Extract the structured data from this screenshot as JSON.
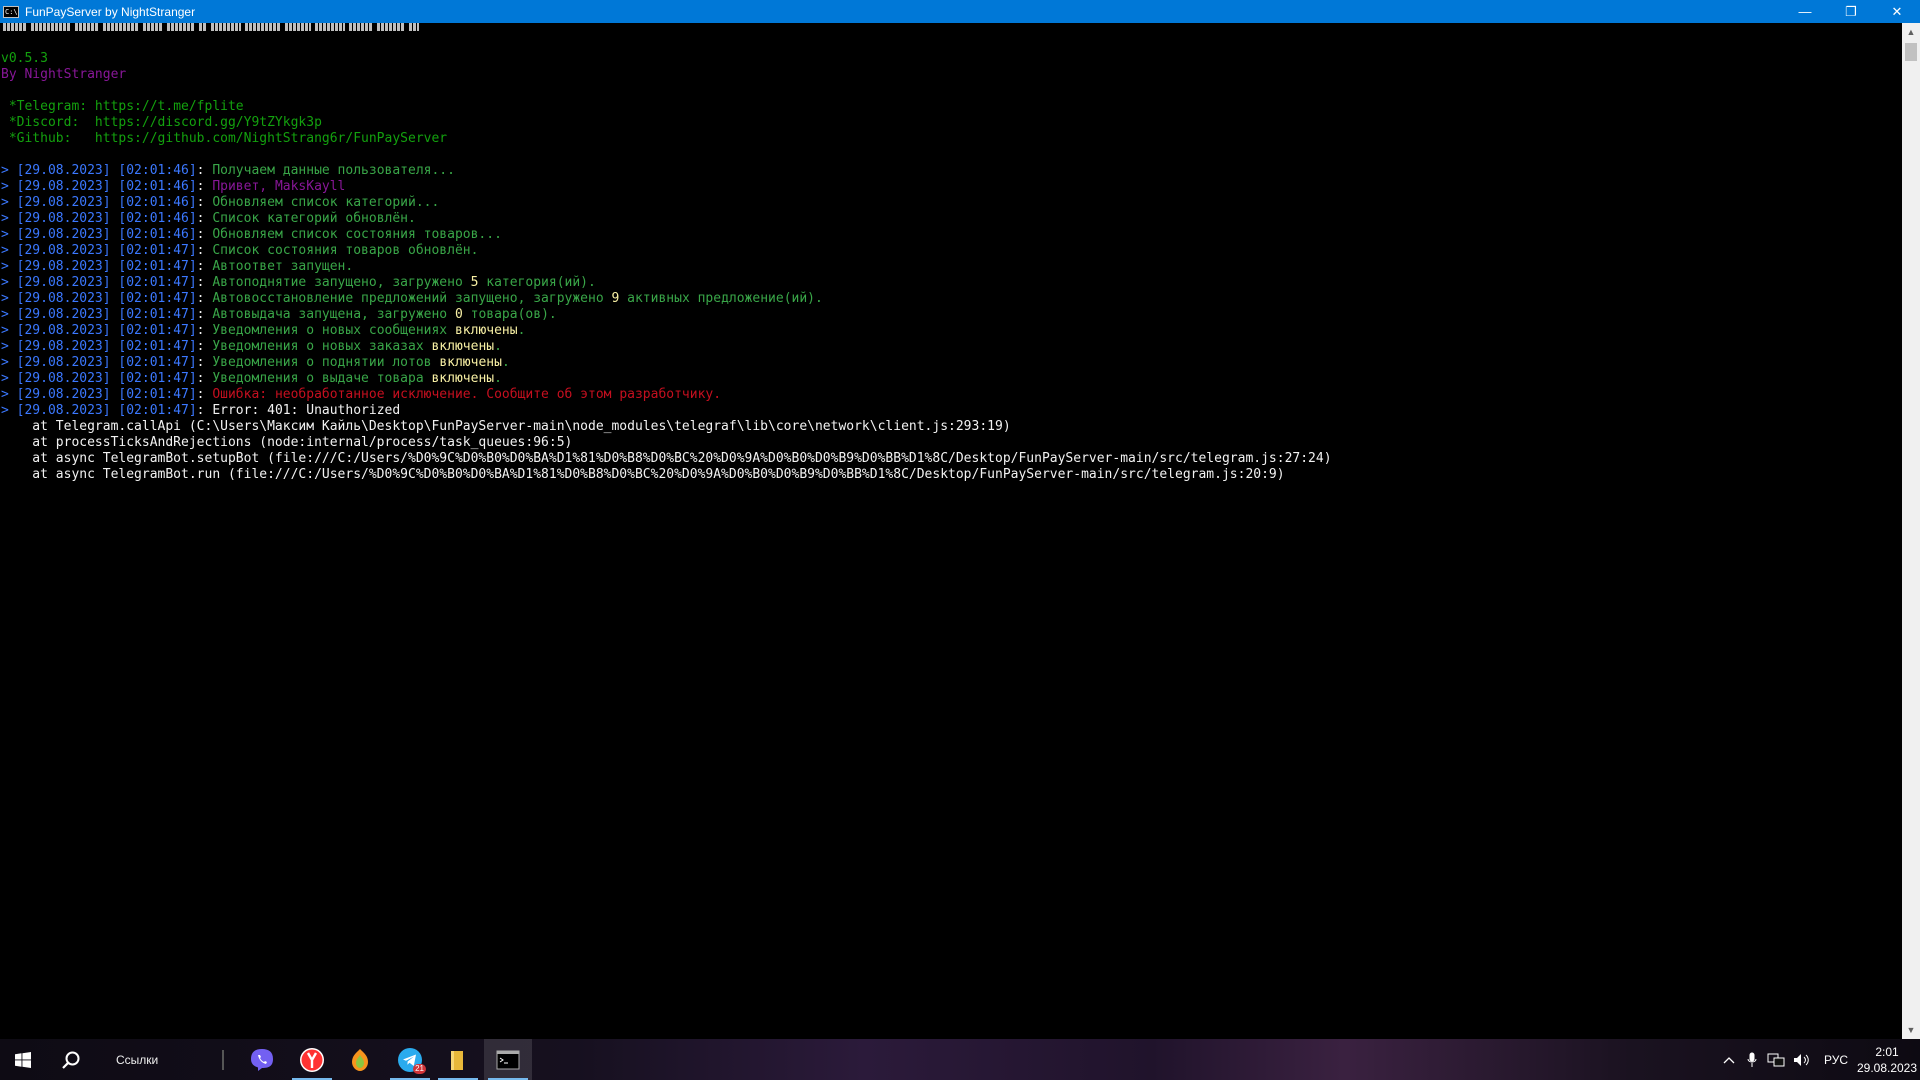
{
  "window": {
    "title": "FunPayServer by NightStranger",
    "app_icon_glyph": "C:\\",
    "minimize_glyph": "—",
    "restore_glyph": "❐",
    "close_glyph": "✕"
  },
  "colors": {
    "gray": "#cccccc",
    "green": "#13a10e",
    "dim_green": "#39a648",
    "magenta": "#881798",
    "yellow": "#f9f1a5",
    "white": "#f2f2f2",
    "red": "#c50f1f",
    "prompt": "#3b78ff"
  },
  "console": {
    "version": "v0.5.3",
    "author": "By NightStranger",
    "links": [
      {
        "label": " *Telegram: ",
        "value": "https://t.me/fplite"
      },
      {
        "label": " *Discord:  ",
        "value": "https://discord.gg/Y9tZYkgk3p"
      },
      {
        "label": " *Github:   ",
        "value": "https://github.com/NightStrang6r/FunPayServer"
      }
    ],
    "log": [
      {
        "ts": "[29.08.2023] [02:01:46]",
        "parts": [
          {
            "t": "Получаем данные пользователя...",
            "c": "dim_green"
          }
        ]
      },
      {
        "ts": "[29.08.2023] [02:01:46]",
        "parts": [
          {
            "t": "Привет, MaksKayll",
            "c": "magenta"
          }
        ]
      },
      {
        "ts": "[29.08.2023] [02:01:46]",
        "parts": [
          {
            "t": "Обновляем список категорий...",
            "c": "dim_green"
          }
        ]
      },
      {
        "ts": "[29.08.2023] [02:01:46]",
        "parts": [
          {
            "t": "Список категорий обновлён.",
            "c": "dim_green"
          }
        ]
      },
      {
        "ts": "[29.08.2023] [02:01:46]",
        "parts": [
          {
            "t": "Обновляем список состояния товаров...",
            "c": "dim_green"
          }
        ]
      },
      {
        "ts": "[29.08.2023] [02:01:47]",
        "parts": [
          {
            "t": "Список состояния товаров обновлён.",
            "c": "dim_green"
          }
        ]
      },
      {
        "ts": "[29.08.2023] [02:01:47]",
        "parts": [
          {
            "t": "Автоответ запущен.",
            "c": "dim_green"
          }
        ]
      },
      {
        "ts": "[29.08.2023] [02:01:47]",
        "parts": [
          {
            "t": "Автоподнятие запущено, загружено ",
            "c": "dim_green"
          },
          {
            "t": "5",
            "c": "yellow"
          },
          {
            "t": " категория(ий).",
            "c": "dim_green"
          }
        ]
      },
      {
        "ts": "[29.08.2023] [02:01:47]",
        "parts": [
          {
            "t": "Автовосстановление предложений запущено, загружено ",
            "c": "dim_green"
          },
          {
            "t": "9",
            "c": "yellow"
          },
          {
            "t": " активных предложение(ий).",
            "c": "dim_green"
          }
        ]
      },
      {
        "ts": "[29.08.2023] [02:01:47]",
        "parts": [
          {
            "t": "Автовыдача запущена, загружено ",
            "c": "dim_green"
          },
          {
            "t": "0",
            "c": "yellow"
          },
          {
            "t": " товара(ов).",
            "c": "dim_green"
          }
        ]
      },
      {
        "ts": "[29.08.2023] [02:01:47]",
        "parts": [
          {
            "t": "Уведомления о новых сообщениях ",
            "c": "dim_green"
          },
          {
            "t": "включены",
            "c": "yellow"
          },
          {
            "t": ".",
            "c": "dim_green"
          }
        ]
      },
      {
        "ts": "[29.08.2023] [02:01:47]",
        "parts": [
          {
            "t": "Уведомления о новых заказах ",
            "c": "dim_green"
          },
          {
            "t": "включены",
            "c": "yellow"
          },
          {
            "t": ".",
            "c": "dim_green"
          }
        ]
      },
      {
        "ts": "[29.08.2023] [02:01:47]",
        "parts": [
          {
            "t": "Уведомления о поднятии лотов ",
            "c": "dim_green"
          },
          {
            "t": "включены",
            "c": "yellow"
          },
          {
            "t": ".",
            "c": "dim_green"
          }
        ]
      },
      {
        "ts": "[29.08.2023] [02:01:47]",
        "parts": [
          {
            "t": "Уведомления о выдаче товара ",
            "c": "dim_green"
          },
          {
            "t": "включены",
            "c": "yellow"
          },
          {
            "t": ".",
            "c": "dim_green"
          }
        ]
      },
      {
        "ts": "[29.08.2023] [02:01:47]",
        "parts": [
          {
            "t": "Ошибка: необработанное исключение. Сообщите об этом разработчику.",
            "c": "red"
          }
        ]
      },
      {
        "ts": "[29.08.2023] [02:01:47]",
        "parts": [
          {
            "t": "Error: 401: Unauthorized",
            "c": "white"
          }
        ]
      }
    ],
    "stack": [
      "    at Telegram.callApi (C:\\Users\\Максим Кайль\\Desktop\\FunPayServer-main\\node_modules\\telegraf\\lib\\core\\network\\client.js:293:19)",
      "    at processTicksAndRejections (node:internal/process/task_queues:96:5)",
      "    at async TelegramBot.setupBot (file:///C:/Users/%D0%9C%D0%B0%D0%BA%D1%81%D0%B8%D0%BC%20%D0%9A%D0%B0%D0%B9%D0%BB%D1%8C/Desktop/FunPayServer-main/src/telegram.js:27:24)",
      "    at async TelegramBot.run (file:///C:/Users/%D0%9C%D0%B0%D0%BA%D1%81%D0%B8%D0%BC%20%D0%9A%D0%B0%D0%B9%D0%BB%D1%8C/Desktop/FunPayServer-main/src/telegram.js:20:9)"
    ],
    "prompt_glyph": "> ",
    "ts_sep": ": "
  },
  "taskbar": {
    "search_text": "Ссылки",
    "telegram_badge": "21",
    "language": "РУС",
    "time": "2:01",
    "date": "29.08.2023",
    "icons": {
      "start": "windows-logo-icon",
      "search": "search-icon",
      "viber": "viber-icon",
      "yandex": "yandex-browser-icon",
      "flstudio": "fl-studio-icon",
      "telegram": "telegram-icon",
      "explorer": "file-explorer-icon",
      "cmd": "command-prompt-icon"
    }
  }
}
